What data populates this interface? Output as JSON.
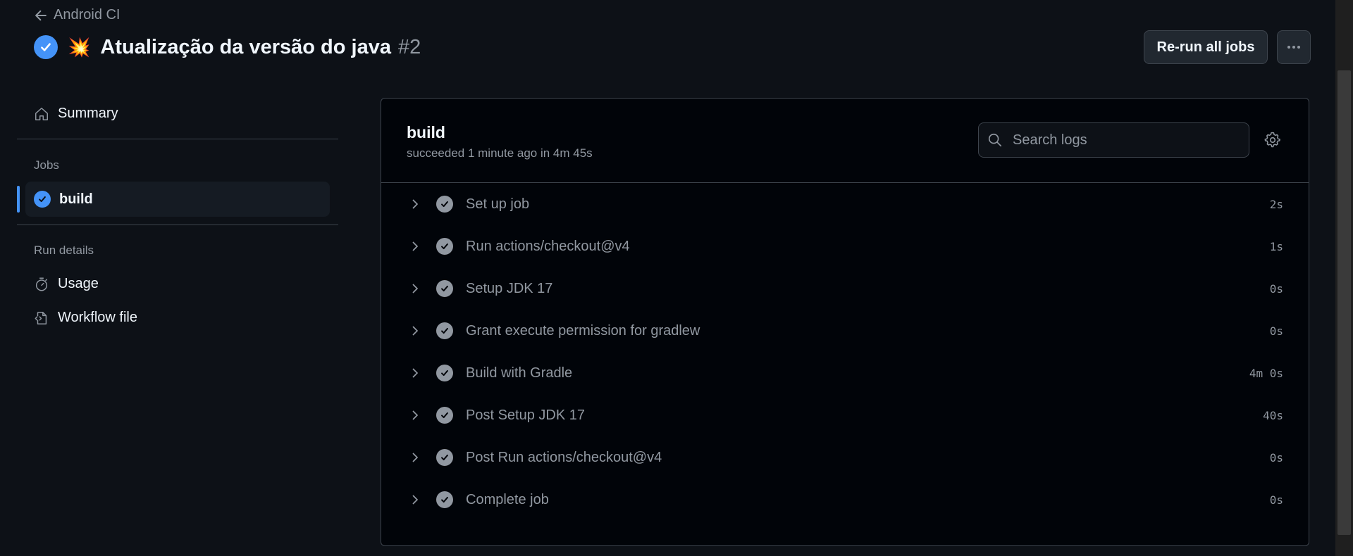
{
  "header": {
    "back_label": "Android CI",
    "emoji": "💥",
    "run_title": "Atualização da versão do java",
    "run_number": "#2",
    "rerun_label": "Re-run all jobs"
  },
  "sidebar": {
    "summary_label": "Summary",
    "jobs_heading": "Jobs",
    "job_label": "build",
    "run_details_heading": "Run details",
    "usage_label": "Usage",
    "workflow_label": "Workflow file"
  },
  "job": {
    "name": "build",
    "meta": "succeeded 1 minute ago in 4m 45s",
    "search_placeholder": "Search logs"
  },
  "steps": [
    {
      "name": "Set up job",
      "duration": "2s"
    },
    {
      "name": "Run actions/checkout@v4",
      "duration": "1s"
    },
    {
      "name": "Setup JDK 17",
      "duration": "0s"
    },
    {
      "name": "Grant execute permission for gradlew",
      "duration": "0s"
    },
    {
      "name": "Build with Gradle",
      "duration": "4m 0s"
    },
    {
      "name": "Post Setup JDK 17",
      "duration": "40s"
    },
    {
      "name": "Post Run actions/checkout@v4",
      "duration": "0s"
    },
    {
      "name": "Complete job",
      "duration": "0s"
    }
  ],
  "colors": {
    "background": "#0d1117",
    "panel": "#010409",
    "accent": "#4493f8",
    "muted": "#9198a1"
  }
}
